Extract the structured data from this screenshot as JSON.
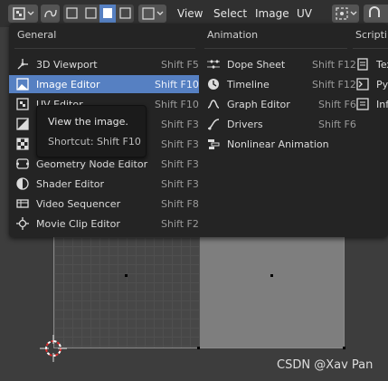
{
  "header": {
    "menus": [
      "View",
      "Select",
      "Image",
      "UV"
    ]
  },
  "popup": {
    "columns": [
      {
        "title": "General",
        "items": [
          {
            "icon": "3d-viewport-icon",
            "label": "3D Viewport",
            "shortcut": "Shift F5",
            "selected": false
          },
          {
            "icon": "image-editor-icon",
            "label": "Image Editor",
            "shortcut": "Shift F10",
            "selected": true
          },
          {
            "icon": "uv-editor-icon",
            "label": "UV Editor",
            "shortcut": "Shift F10",
            "selected": false
          },
          {
            "icon": "compositor-icon",
            "label": "",
            "shortcut": "Shift F3",
            "selected": false
          },
          {
            "icon": "texture-node-icon",
            "label": "",
            "shortcut": "Shift F3",
            "selected": false
          },
          {
            "icon": "geometry-node-icon",
            "label": "Geometry Node Editor",
            "shortcut": "Shift F3",
            "selected": false
          },
          {
            "icon": "shader-editor-icon",
            "label": "Shader Editor",
            "shortcut": "Shift F3",
            "selected": false
          },
          {
            "icon": "video-sequencer-icon",
            "label": "Video Sequencer",
            "shortcut": "Shift F8",
            "selected": false
          },
          {
            "icon": "movie-clip-icon",
            "label": "Movie Clip Editor",
            "shortcut": "Shift F2",
            "selected": false
          }
        ]
      },
      {
        "title": "Animation",
        "items": [
          {
            "icon": "dope-sheet-icon",
            "label": "Dope Sheet",
            "shortcut": "Shift F12"
          },
          {
            "icon": "timeline-icon",
            "label": "Timeline",
            "shortcut": "Shift F12"
          },
          {
            "icon": "graph-editor-icon",
            "label": "Graph Editor",
            "shortcut": "Shift F6"
          },
          {
            "icon": "drivers-icon",
            "label": "Drivers",
            "shortcut": "Shift F6"
          },
          {
            "icon": "nla-icon",
            "label": "Nonlinear Animation",
            "shortcut": ""
          }
        ]
      },
      {
        "title": "Scriptin",
        "items": [
          {
            "icon": "text-editor-icon",
            "label": "Tex"
          },
          {
            "icon": "python-console-icon",
            "label": "Pyt"
          },
          {
            "icon": "info-icon",
            "label": "Info"
          }
        ]
      }
    ]
  },
  "tooltip": {
    "description": "View the image.",
    "shortcut": "Shortcut: Shift F10"
  },
  "watermark": "CSDN @Xav Pan",
  "colors": {
    "selection": "#5680c2",
    "popup_bg": "#242424",
    "topbar_bg": "#303030"
  }
}
